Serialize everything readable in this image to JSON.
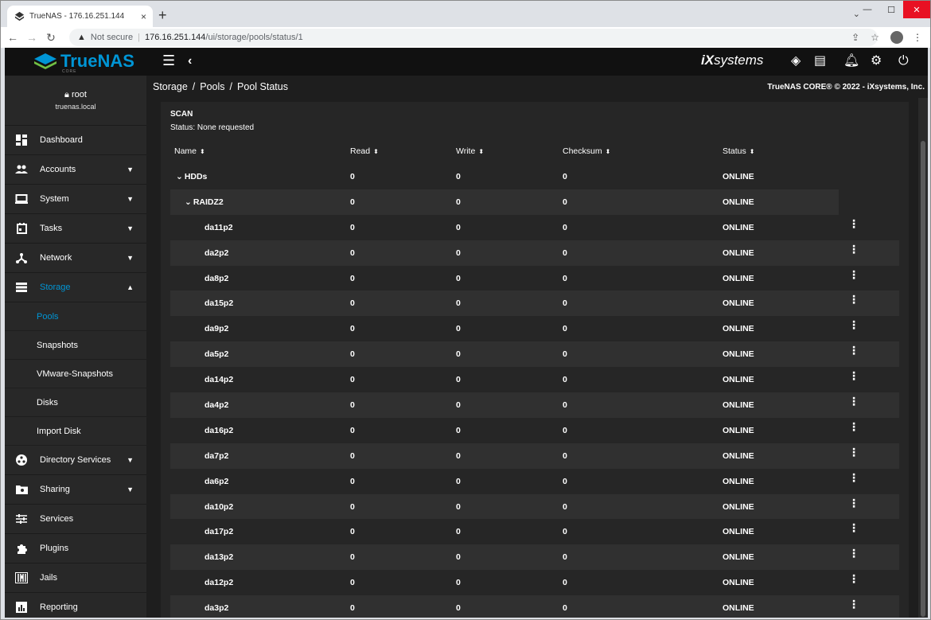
{
  "browser": {
    "tab_title": "TrueNAS - 176.16.251.144",
    "tab_close": "×",
    "new_tab": "+",
    "security_label": "Not secure",
    "url_host": "176.16.251.144",
    "url_path": "/ui/storage/pools/status/1"
  },
  "app": {
    "logo_text": "TrueNAS",
    "logo_sub": "CORE",
    "vendor_logo": "systems",
    "breadcrumb": [
      "Storage",
      "Pools",
      "Pool Status"
    ],
    "breadcrumb_sep": "/",
    "copyright": "TrueNAS CORE® © 2022 - iXsystems, Inc."
  },
  "user": {
    "name": "root",
    "host": "truenas.local"
  },
  "sidebar": {
    "items": [
      {
        "label": "Dashboard",
        "icon": "dashboard-icon",
        "chevron": ""
      },
      {
        "label": "Accounts",
        "icon": "accounts-icon",
        "chevron": "▼"
      },
      {
        "label": "System",
        "icon": "system-icon",
        "chevron": "▼"
      },
      {
        "label": "Tasks",
        "icon": "tasks-icon",
        "chevron": "▼"
      },
      {
        "label": "Network",
        "icon": "network-icon",
        "chevron": "▼"
      },
      {
        "label": "Storage",
        "icon": "storage-icon",
        "chevron": "▲"
      }
    ],
    "storage_sub": [
      "Pools",
      "Snapshots",
      "VMware-Snapshots",
      "Disks",
      "Import Disk"
    ],
    "items_after": [
      {
        "label": "Directory Services",
        "icon": "directory-services-icon",
        "chevron": "▼"
      },
      {
        "label": "Sharing",
        "icon": "sharing-icon",
        "chevron": "▼"
      },
      {
        "label": "Services",
        "icon": "services-icon",
        "chevron": ""
      },
      {
        "label": "Plugins",
        "icon": "plugins-icon",
        "chevron": ""
      },
      {
        "label": "Jails",
        "icon": "jails-icon",
        "chevron": ""
      },
      {
        "label": "Reporting",
        "icon": "reporting-icon",
        "chevron": ""
      }
    ]
  },
  "scan": {
    "title": "SCAN",
    "status": "Status: None requested"
  },
  "table": {
    "headers": [
      "Name",
      "Read",
      "Write",
      "Checksum",
      "Status"
    ],
    "sort_glyph": "⬍",
    "menu_glyph": "⋮",
    "rows": [
      {
        "name": "HDDs",
        "level": 0,
        "expand": "⌄",
        "read": "0",
        "write": "0",
        "checksum": "0",
        "status": "ONLINE"
      },
      {
        "name": "RAIDZ2",
        "level": 1,
        "expand": "⌄",
        "read": "0",
        "write": "0",
        "checksum": "0",
        "status": "ONLINE"
      },
      {
        "name": "da11p2",
        "level": 2,
        "read": "0",
        "write": "0",
        "checksum": "0",
        "status": "ONLINE"
      },
      {
        "name": "da2p2",
        "level": 2,
        "read": "0",
        "write": "0",
        "checksum": "0",
        "status": "ONLINE"
      },
      {
        "name": "da8p2",
        "level": 2,
        "read": "0",
        "write": "0",
        "checksum": "0",
        "status": "ONLINE"
      },
      {
        "name": "da15p2",
        "level": 2,
        "read": "0",
        "write": "0",
        "checksum": "0",
        "status": "ONLINE"
      },
      {
        "name": "da9p2",
        "level": 2,
        "read": "0",
        "write": "0",
        "checksum": "0",
        "status": "ONLINE"
      },
      {
        "name": "da5p2",
        "level": 2,
        "read": "0",
        "write": "0",
        "checksum": "0",
        "status": "ONLINE"
      },
      {
        "name": "da14p2",
        "level": 2,
        "read": "0",
        "write": "0",
        "checksum": "0",
        "status": "ONLINE"
      },
      {
        "name": "da4p2",
        "level": 2,
        "read": "0",
        "write": "0",
        "checksum": "0",
        "status": "ONLINE"
      },
      {
        "name": "da16p2",
        "level": 2,
        "read": "0",
        "write": "0",
        "checksum": "0",
        "status": "ONLINE"
      },
      {
        "name": "da7p2",
        "level": 2,
        "read": "0",
        "write": "0",
        "checksum": "0",
        "status": "ONLINE"
      },
      {
        "name": "da6p2",
        "level": 2,
        "read": "0",
        "write": "0",
        "checksum": "0",
        "status": "ONLINE"
      },
      {
        "name": "da10p2",
        "level": 2,
        "read": "0",
        "write": "0",
        "checksum": "0",
        "status": "ONLINE"
      },
      {
        "name": "da17p2",
        "level": 2,
        "read": "0",
        "write": "0",
        "checksum": "0",
        "status": "ONLINE"
      },
      {
        "name": "da13p2",
        "level": 2,
        "read": "0",
        "write": "0",
        "checksum": "0",
        "status": "ONLINE"
      },
      {
        "name": "da12p2",
        "level": 2,
        "read": "0",
        "write": "0",
        "checksum": "0",
        "status": "ONLINE"
      },
      {
        "name": "da3p2",
        "level": 2,
        "read": "0",
        "write": "0",
        "checksum": "0",
        "status": "ONLINE"
      }
    ]
  },
  "colors": {
    "accent": "#0095d5",
    "bg": "#1e1e1e",
    "sidebar": "#282828",
    "row_alt": "#303030"
  }
}
